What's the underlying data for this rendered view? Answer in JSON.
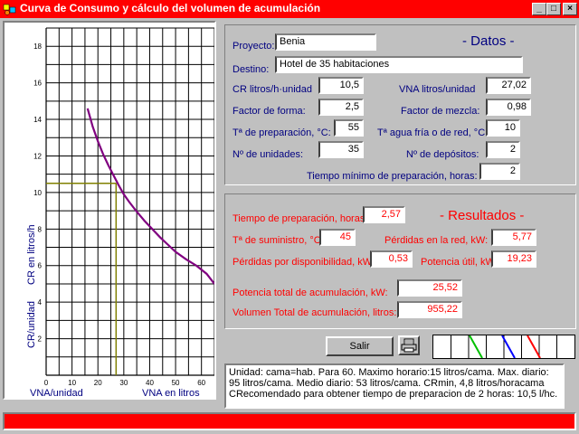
{
  "window": {
    "title": "Curva de Consumo y cálculo del volumen de acumulación",
    "minimize_glyph": "_",
    "maximize_glyph": "□",
    "close_glyph": "×",
    "app_icon": "app-icon"
  },
  "datos": {
    "section_title": "- Datos -",
    "proyecto": {
      "label": "Proyecto:",
      "value": "Benia"
    },
    "destino": {
      "label": "Destino:",
      "value": "Hotel de 35 habitaciones"
    },
    "cr": {
      "label": "CR litros/h·unidad",
      "value": "10,5"
    },
    "vna": {
      "label": "VNA litros/unidad",
      "value": "27,02"
    },
    "factor_forma": {
      "label": "Factor de forma:",
      "value": "2,5"
    },
    "factor_mezcla": {
      "label": "Factor de mezcla:",
      "value": "0,98"
    },
    "t_preparacion": {
      "label": "Tª de preparación, °C:",
      "value": "55"
    },
    "t_agua_fria": {
      "label": "Tª agua fría o de red, °C:",
      "value": "10"
    },
    "n_unidades": {
      "label": "Nº de unidades:",
      "value": "35"
    },
    "n_depositos": {
      "label": "Nº de depósitos:",
      "value": "2"
    },
    "tiempo_minimo": {
      "label": "Tiempo mínimo de preparación, horas:",
      "value": "2"
    }
  },
  "resultados": {
    "section_title": "- Resultados -",
    "tiempo_preparacion": {
      "label": "Tiempo de preparación, horas:",
      "value": "2,57"
    },
    "t_suministro": {
      "label": "Tª de suministro, °C:",
      "value": "45"
    },
    "perdidas_red": {
      "label": "Pérdidas en la red, kW:",
      "value": "5,77"
    },
    "perdidas_disponibilidad": {
      "label": "Pérdidas por disponibilidad, kW:",
      "value": "0,53"
    },
    "potencia_util": {
      "label": "Potencia útil, kW",
      "value": "19,23"
    },
    "potencia_total": {
      "label": "Potencia total de acumulación, kW:",
      "value": "25,52"
    },
    "volumen_total": {
      "label": "Volumen Total de acumulación, litros:",
      "value": "955,22"
    }
  },
  "buttons": {
    "salir": "Salir",
    "print_icon": "printer-icon"
  },
  "info_text": [
    "Unidad: cama=hab. Para 60. Maximo horario:15 litros/cama. Max. diario:",
    "95 litros/cama. Medio diario: 53 litros/cama. CRmin, 4,8 litros/horacama",
    "CRecomendado para obtener tiempo de preparacion de 2 horas: 10,5 l/hc."
  ],
  "colors": {
    "accent": "#ff0000",
    "label_blue": "#000080",
    "curve": "#800080",
    "guide": "#808000"
  },
  "chart_data": {
    "type": "line",
    "xlabel_left": "VNA/unidad",
    "xlabel_right": "VNA en litros",
    "ylabel_top": "CR  en litros/h",
    "ylabel_bottom": "CR/unidad",
    "xlim": [
      0,
      65
    ],
    "ylim": [
      0,
      19
    ],
    "x_ticks": [
      0,
      10,
      20,
      30,
      40,
      50,
      60
    ],
    "y_ticks": [
      2,
      4,
      6,
      8,
      10,
      12,
      14,
      16,
      18
    ],
    "grid": true,
    "series": [
      {
        "x": [
          16,
          18,
          20,
          22,
          24,
          26,
          28,
          30,
          32,
          35,
          38,
          41,
          44,
          47,
          50,
          54,
          58,
          62,
          65
        ],
        "y": [
          14.6,
          13.6,
          12.8,
          12.1,
          11.5,
          10.95,
          10.4,
          9.9,
          9.5,
          8.95,
          8.45,
          8.0,
          7.55,
          7.15,
          6.75,
          6.35,
          6.0,
          5.55,
          5.0
        ]
      }
    ],
    "guide": {
      "x": 27.02,
      "y": 10.5
    }
  },
  "legend_lines": [
    {
      "color": "#00c000"
    },
    {
      "color": "#0000ff"
    },
    {
      "color": "#ff0000"
    }
  ]
}
